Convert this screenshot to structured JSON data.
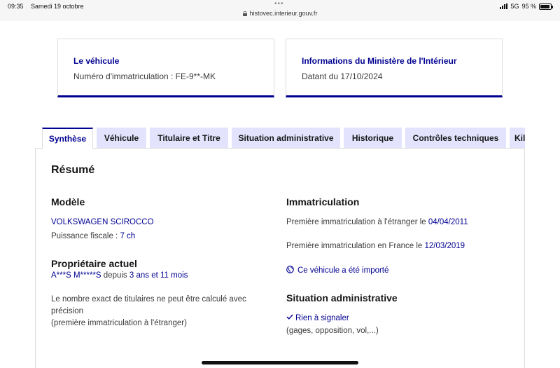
{
  "statusbar": {
    "time": "09:35",
    "date": "Samedi 19 octobre",
    "url": "histovec.interieur.gouv.fr",
    "network": "5G",
    "battery": "95 %",
    "battery_level": 0.95
  },
  "cards": {
    "vehicle": {
      "title": "Le véhicule",
      "text": "Numéro d'immatriculation : FE-9**-MK"
    },
    "ministry": {
      "title": "Informations du Ministère de l'Intérieur",
      "text": "Datant du 17/10/2024"
    }
  },
  "tabs": [
    {
      "label": "Synthèse",
      "active": true
    },
    {
      "label": "Véhicule",
      "active": false
    },
    {
      "label": "Titulaire et Titre",
      "active": false
    },
    {
      "label": "Situation administrative",
      "active": false
    },
    {
      "label": "Historique",
      "active": false
    },
    {
      "label": "Contrôles techniques",
      "active": false
    },
    {
      "label": "Kilo",
      "active": false
    }
  ],
  "summary": {
    "title": "Résumé",
    "modele": {
      "heading": "Modèle",
      "name": "VOLKSWAGEN SCIROCCO",
      "power_label": "Puissance fiscale : ",
      "power_value": "7 ch"
    },
    "owner": {
      "heading": "Propriétaire actuel",
      "name": "A***S M*****S",
      "since_label": " depuis ",
      "since_value": "3 ans et 11 mois",
      "note_line1": "Le nombre exact de titulaires ne peut être calculé avec",
      "note_line2": "précision",
      "note_line3": "(première immatriculation à l'étranger)"
    },
    "immatriculation": {
      "heading": "Immatriculation",
      "foreign_label": "Première immatriculation à l'étranger le ",
      "foreign_date": "04/04/2011",
      "france_label": "Première immatriculation en France le ",
      "france_date": "12/03/2019",
      "imported": "Ce véhicule a été importé"
    },
    "situation": {
      "heading": "Situation administrative",
      "status": "Rien à signaler",
      "details": "(gages, opposition, vol,...)"
    }
  },
  "colors": {
    "accent": "#000091",
    "tab_background": "#e3e3fd",
    "text": "#161616"
  }
}
